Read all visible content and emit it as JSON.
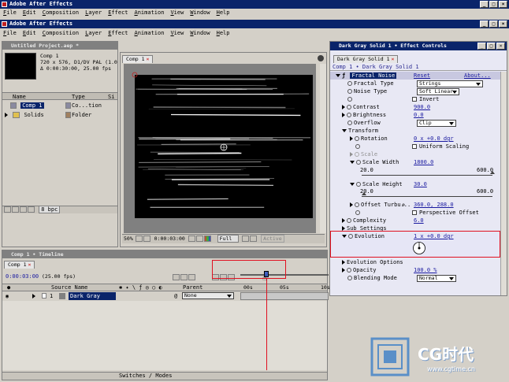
{
  "app": {
    "title": "Adobe After Effects",
    "inner_title": "Adobe After Effects"
  },
  "menu": [
    "File",
    "Edit",
    "Composition",
    "Layer",
    "Effect",
    "Animation",
    "View",
    "Window",
    "Help"
  ],
  "project": {
    "title": "Untitled Project.aep *",
    "selected_name": "Comp 1",
    "info_line1": "720 x 576, D1/DV PAL (1.0",
    "info_line2": "Δ 0:00:30:00, 25.00 fps",
    "col_name": "Name",
    "col_type": "Type",
    "col_size": "Si",
    "items": [
      {
        "name": "Comp 1",
        "type": "Co...tion"
      },
      {
        "name": "Solids",
        "type": "Folder"
      }
    ],
    "bpc": "8 bpc"
  },
  "comp": {
    "tab": "Comp 1",
    "zoom": "50%",
    "time": "0:00:03:00",
    "resolution": "Full",
    "camera": "Active"
  },
  "effect": {
    "title": "Dark Gray Solid 1 • Effect Controls",
    "tab": "Dark Gray Solid 1",
    "breadcrumb": "Comp 1 • Dark Gray Solid 1",
    "effect_name": "Fractal Noise",
    "reset": "Reset",
    "about": "About...",
    "fractal_type_label": "Fractal Type",
    "fractal_type": "Strings",
    "noise_type_label": "Noise Type",
    "noise_type": "Soft Linear",
    "invert": "Invert",
    "contrast_label": "Contrast",
    "contrast": "900.0",
    "brightness_label": "Brightness",
    "brightness": "0.0",
    "overflow_label": "Overflow",
    "overflow": "Clip",
    "transform_label": "Transform",
    "rotation_label": "Rotation",
    "rotation": "0 x +0.0 dgr",
    "uniform_scaling": "Uniform Scaling",
    "scale_label": "Scale",
    "scale_width_label": "Scale Width",
    "scale_width": "1800.0",
    "scale_width_min": "20.0",
    "scale_width_max": "600.0",
    "scale_width_pos": 1.0,
    "scale_height_label": "Scale Height",
    "scale_height": "30.0",
    "scale_height_min": "20.0",
    "scale_height_max": "600.0",
    "scale_height_pos": 0.017,
    "offset_label": "Offset Turbu...",
    "offset": "360.0, 288.0",
    "perspective": "Perspective Offset",
    "complexity_label": "Complexity",
    "complexity": "6.0",
    "sub_settings": "Sub Settings",
    "evolution_label": "Evolution",
    "evolution": "1 x +0.0 dgr",
    "evolution_options": "Evolution Options",
    "opacity_label": "Opacity",
    "opacity": "100.0 %",
    "blending_label": "Blending Mode",
    "blending": "Normal"
  },
  "timeline": {
    "title": "Comp 1 • Timeline",
    "tab": "Comp 1",
    "time": "0:00:03:00",
    "fps": "(25.00 fps)",
    "col_source": "Source Name",
    "col_parent": "Parent",
    "layer_num": "1",
    "layer_name": "Dark Gray",
    "parent": "None",
    "ruler": [
      "00s",
      "05s",
      "10s"
    ],
    "footer": "Switches / Modes"
  },
  "watermark": {
    "brand": "CG时代",
    "url": "www.cgtime.cn"
  },
  "colors": {
    "titlebar": "#0a246a",
    "highlight": "#e01020",
    "panel": "#d4d0c8",
    "effect_bg": "#e8e8f4"
  }
}
